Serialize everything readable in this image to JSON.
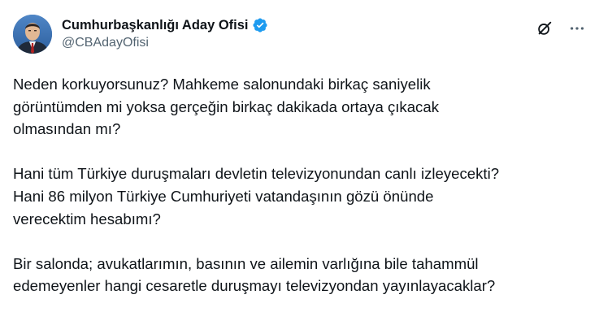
{
  "account": {
    "display_name": "Cumhurbaşkanlığı Aday Ofisi",
    "handle": "@CBAdayOfisi",
    "verified": true,
    "verified_color": "#1d9bf0"
  },
  "actions": {
    "grok_icon": "grok-icon",
    "more_icon": "more-horizontal-icon"
  },
  "tweet": {
    "paragraphs": [
      "Neden korkuyorsunuz? Mahkeme salonundaki birkaç saniyelik\ngörüntümden mi yoksa gerçeğin birkaç dakikada ortaya çıkacak\nolmasından mı?",
      "Hani tüm Türkiye duruşmaları devletin televizyonundan canlı izleyecekti?\nHani 86 milyon Türkiye Cumhuriyeti vatandaşının gözü önünde\nverecektim hesabımı?",
      "Bir salonda; avukatlarımın, basının ve ailemin varlığına bile tahammül\nedemeyenler hangi cesaretle duruşmayı televizyondan yayınlayacaklar?"
    ]
  }
}
